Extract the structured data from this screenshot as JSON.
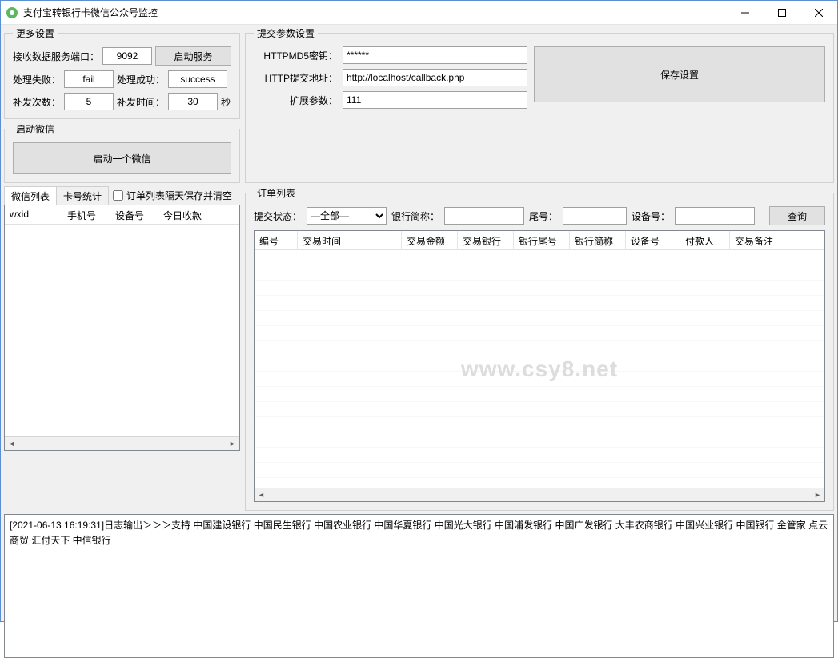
{
  "window": {
    "title": "支付宝转银行卡微信公众号监控"
  },
  "more_settings": {
    "legend": "更多设置",
    "port_label": "接收数据服务端口：",
    "port_value": "9092",
    "start_service_btn": "启动服务",
    "fail_label": "处理失败：",
    "fail_value": "fail",
    "success_label": "处理成功：",
    "success_value": "success",
    "retry_count_label": "补发次数：",
    "retry_count_value": "5",
    "retry_interval_label": "补发时间：",
    "retry_interval_value": "30",
    "seconds": "秒"
  },
  "start_wechat": {
    "legend": "启动微信",
    "button": "启动一个微信"
  },
  "submit_params": {
    "legend": "提交参数设置",
    "md5_label": "HTTPMD5密钥：",
    "md5_value": "******",
    "url_label": "HTTP提交地址：",
    "url_value": "http://localhost/callback.php",
    "ext_label": "扩展参数：",
    "ext_value": "111",
    "save_btn": "保存设置"
  },
  "wechat_tabs": {
    "tab1": "微信列表",
    "tab2": "卡号统计",
    "checkbox_label": "订单列表隔天保存并清空"
  },
  "wechat_table": {
    "col1": "wxid",
    "col2": "手机号",
    "col3": "设备号",
    "col4": "今日收款"
  },
  "order_list": {
    "legend": "订单列表",
    "status_label": "提交状态：",
    "status_options": [
      "—全部—"
    ],
    "bank_abbr_label": "银行简称：",
    "tail_label": "尾号：",
    "device_label": "设备号：",
    "query_btn": "查询",
    "columns": [
      "编号",
      "交易时间",
      "交易金额",
      "交易银行",
      "银行尾号",
      "银行简称",
      "设备号",
      "付款人",
      "交易备注"
    ]
  },
  "watermark": "www.csy8.net",
  "log": "[2021-06-13 16:19:31]日志输出＞＞＞支持  中国建设银行  中国民生银行  中国农业银行  中国华夏银行  中国光大银行  中国浦发银行  中国广发银行  大丰农商银行  中国兴业银行 中国银行 金管家 点云商贸 汇付天下 中信银行"
}
